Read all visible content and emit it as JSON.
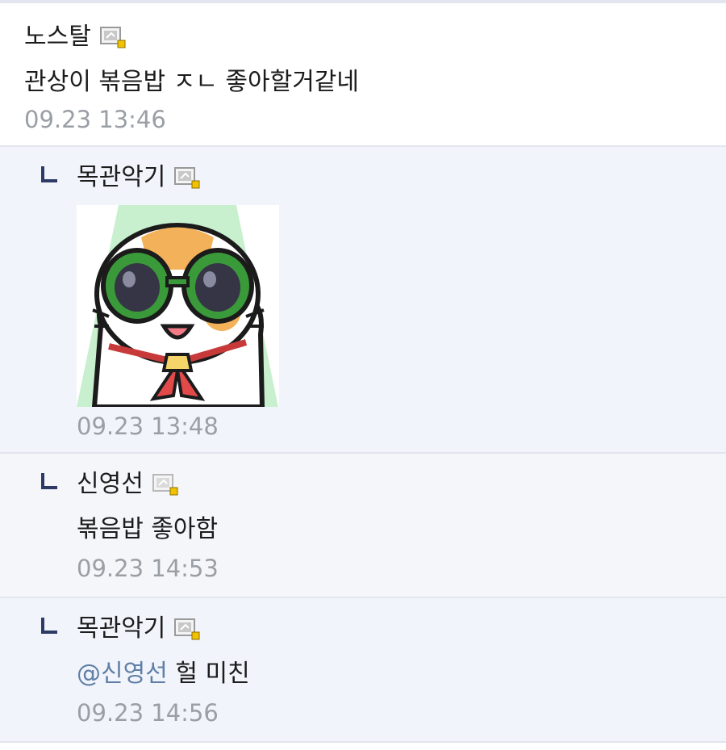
{
  "comments": [
    {
      "author": "노스탈",
      "text": "관상이 볶음밥 ㅈㄴ 좋아할거같네",
      "time": "09.23 13:46"
    },
    {
      "author": "목관악기",
      "sticker": "cat-with-green-sunglasses-sticker",
      "time": "09.23 13:48"
    },
    {
      "author": "신영선",
      "text": "볶음밥 좋아함",
      "time": "09.23 14:53"
    },
    {
      "author": "목관악기",
      "mention": "@신영선",
      "text": "헐 미친",
      "time": "09.23 14:56"
    }
  ],
  "icons": {
    "reply": "reply-arrow-icon",
    "user_badge": "user-badge-icon"
  },
  "colors": {
    "reply_bg": "#f2f4fb",
    "mention": "#5f7fa6",
    "timestamp": "#9a9ea5",
    "reply_mark": "#2e3a66",
    "badge_accent": "#f2c200"
  }
}
